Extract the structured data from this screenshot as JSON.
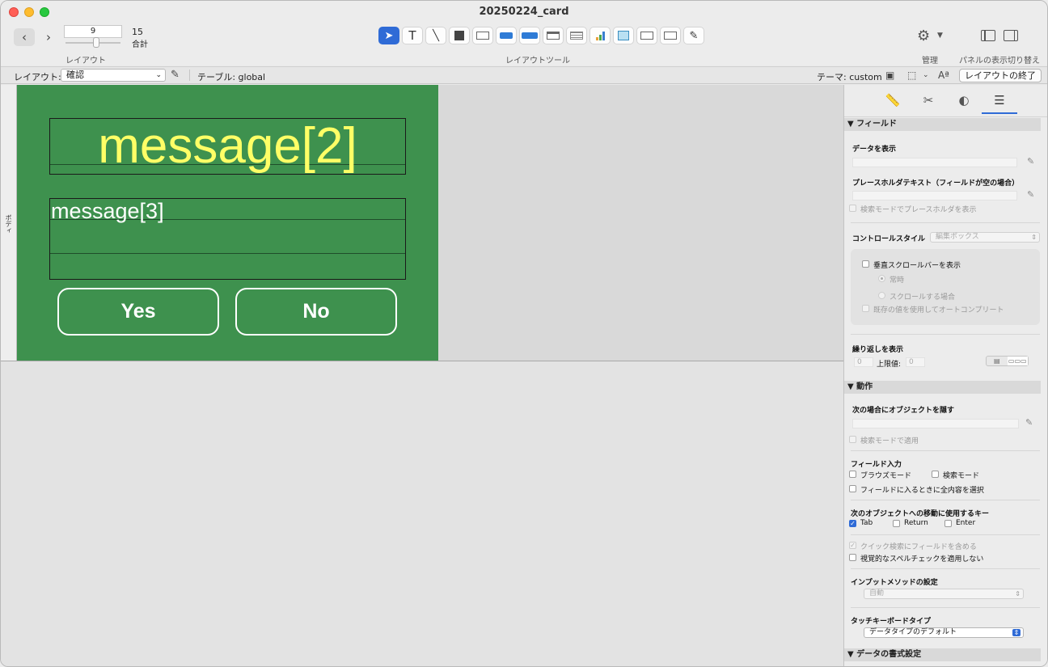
{
  "window": {
    "title": "20250224_card"
  },
  "toolbar": {
    "record_number": "9",
    "total_count": "15",
    "total_label": "合計",
    "layout_caption": "レイアウト",
    "tools_caption": "レイアウトツール",
    "manage_caption": "管理",
    "panel_caption": "パネルの表示切り替え",
    "tools": [
      "pointer-tool",
      "text-tool",
      "line-tool",
      "shape-tool",
      "field-tool",
      "button-tool",
      "button-bar-tool",
      "tab-control-tool",
      "portal-tool",
      "chart-tool",
      "web-viewer-tool",
      "popover-tool",
      "popover-button-tool",
      "format-painter-tool"
    ]
  },
  "layoutbar": {
    "layout_label": "レイアウト:",
    "layout_value": "確認",
    "table_label": "テーブル: global",
    "theme_label": "テーマ: custom",
    "exit_button": "レイアウトの終了"
  },
  "canvas": {
    "part_label": "ボディ",
    "field_message2": "message[2]",
    "field_message3": "message[3]",
    "button_yes": "Yes",
    "button_no": "No",
    "colors": {
      "body_bg": "#3e914e",
      "msg2_text": "#ffff66"
    }
  },
  "inspector": {
    "sections": {
      "field": "▼ フィールド",
      "behavior": "▼ 動作",
      "data_format": "▼ データの書式設定"
    },
    "show_data": "データを表示",
    "placeholder_label": "プレースホルダテキスト（フィールドが空の場合）",
    "placeholder_find": "検索モードでプレースホルダを表示",
    "control_style_label": "コントロールスタイル",
    "control_style_value": "編集ボックス",
    "vscroll": "垂直スクロールバーを表示",
    "always": "常時",
    "when_scrolling": "スクロールする場合",
    "autocomplete": "既存の値を使用してオートコンプリート",
    "repetitions_label": "繰り返しを表示",
    "rep_from": "0",
    "rep_upper_label": "上限値:",
    "rep_upper": "0",
    "hide_object": "次の場合にオブジェクトを隠す",
    "apply_in_find": "検索モードで適用",
    "field_entry": "フィールド入力",
    "browse_mode": "ブラウズモード",
    "find_mode": "検索モード",
    "select_all": "フィールドに入るときに全内容を選択",
    "goto_next_keys": "次のオブジェクトへの移動に使用するキー",
    "key_tab": "Tab",
    "key_return": "Return",
    "key_enter": "Enter",
    "quick_find": "クイック検索にフィールドを含める",
    "spellcheck": "視覚的なスペルチェックを適用しない",
    "input_method_label": "インプットメソッドの設定",
    "input_method_value": "自動",
    "touch_keyboard_label": "タッチキーボードタイプ",
    "touch_keyboard_value": "データタイプのデフォルト"
  }
}
